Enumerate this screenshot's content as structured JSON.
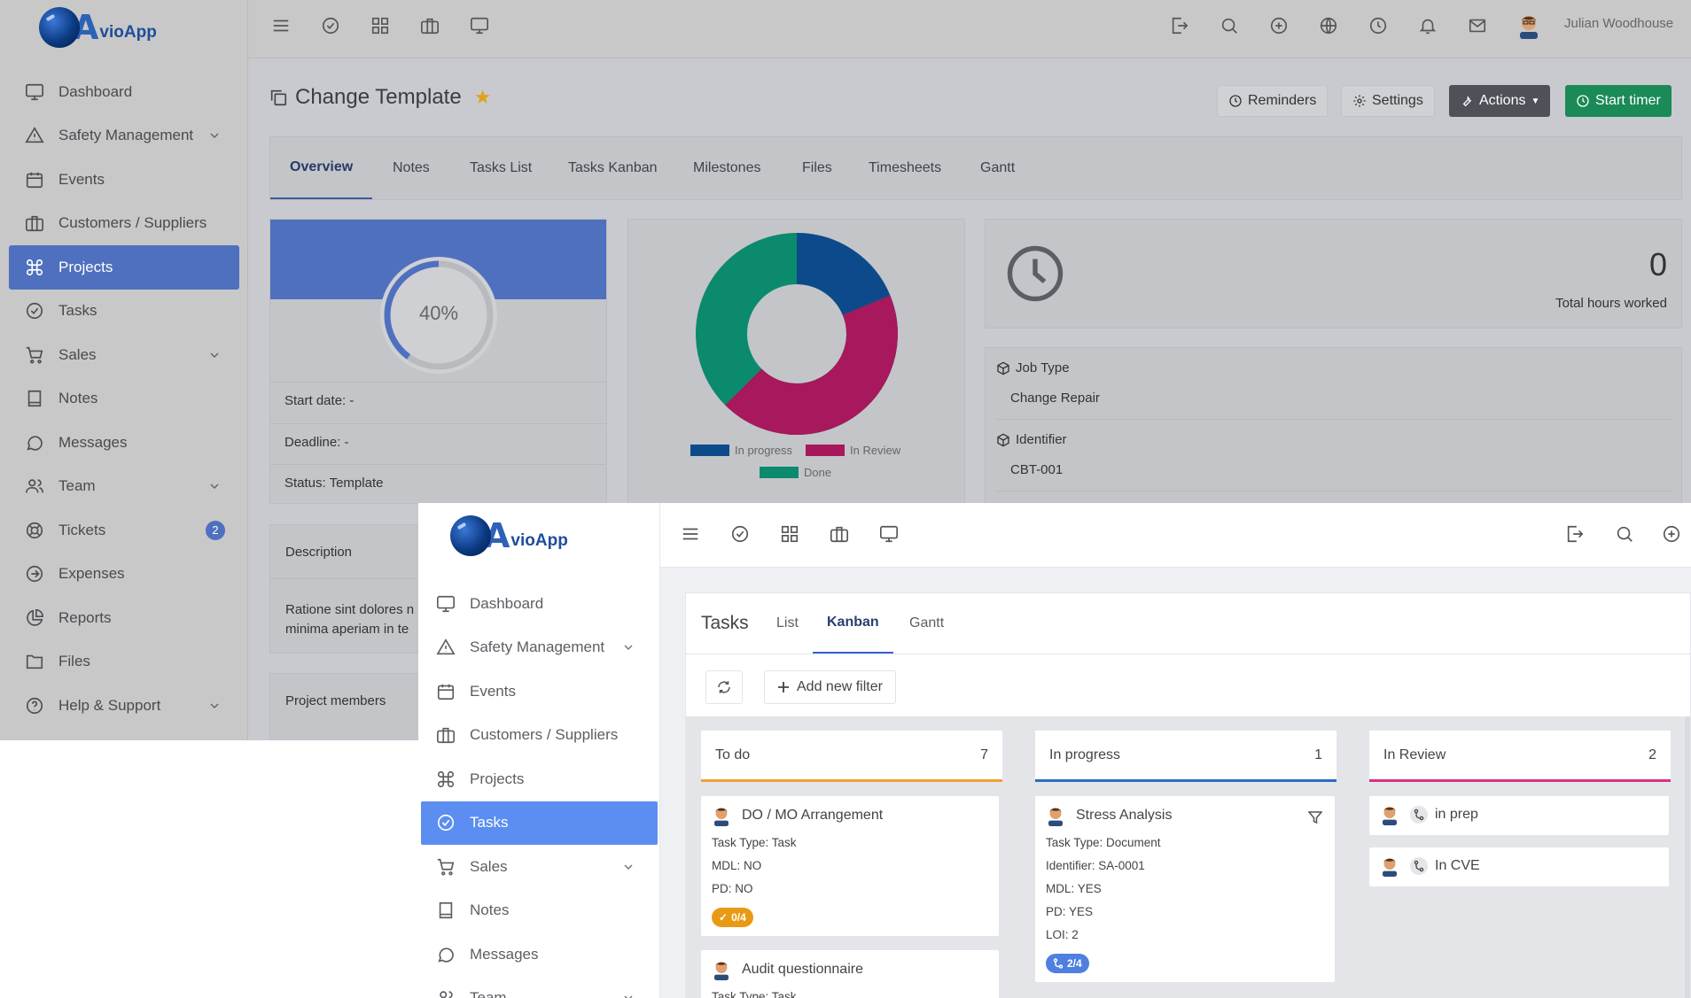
{
  "app": {
    "name_A": "A",
    "name_rest": "vioApp"
  },
  "user": {
    "name": "Julian Woodhouse"
  },
  "back": {
    "nav": [
      {
        "label": "Dashboard",
        "icon": "monitor-icon"
      },
      {
        "label": "Safety Management",
        "icon": "warning-icon",
        "has_children": true
      },
      {
        "label": "Events",
        "icon": "calendar-icon"
      },
      {
        "label": "Customers / Suppliers",
        "icon": "briefcase-icon"
      },
      {
        "label": "Projects",
        "icon": "command-icon",
        "active": true
      },
      {
        "label": "Tasks",
        "icon": "check-circle-icon"
      },
      {
        "label": "Sales",
        "icon": "cart-icon",
        "has_children": true
      },
      {
        "label": "Notes",
        "icon": "book-icon"
      },
      {
        "label": "Messages",
        "icon": "chat-icon"
      },
      {
        "label": "Team",
        "icon": "users-icon",
        "has_children": true
      },
      {
        "label": "Tickets",
        "icon": "lifebuoy-icon",
        "badge": "2"
      },
      {
        "label": "Expenses",
        "icon": "arrow-circle-icon"
      },
      {
        "label": "Reports",
        "icon": "pie-icon"
      },
      {
        "label": "Files",
        "icon": "folder-icon"
      },
      {
        "label": "Help & Support",
        "icon": "help-icon",
        "has_children": true
      }
    ],
    "page_title": "Change Template",
    "buttons": {
      "reminders": "Reminders",
      "settings": "Settings",
      "actions": "Actions",
      "start_timer": "Start timer"
    },
    "tabs": [
      "Overview",
      "Notes",
      "Tasks List",
      "Tasks Kanban",
      "Milestones",
      "Files",
      "Timesheets",
      "Gantt"
    ],
    "progress": {
      "percent_label": "40%",
      "value": 0.4
    },
    "info": {
      "start_date": "Start date: -",
      "deadline": "Deadline: -",
      "status": "Status: Template"
    },
    "donut_chart": {
      "legend": [
        "In progress",
        "In Review",
        "Done"
      ],
      "colors": {
        "in_progress": "#0d4a8c",
        "in_review": "#a8185c",
        "done": "#0b8a6d"
      }
    },
    "hours": {
      "value": "0",
      "label": "Total hours worked"
    },
    "fields": [
      {
        "label": "Job Type",
        "value": "Change Repair"
      },
      {
        "label": "Identifier",
        "value": "CBT-001"
      }
    ],
    "description": {
      "label": "Description",
      "text_line1": "Ratione sint dolores n",
      "text_line2": "minima aperiam in te"
    },
    "project_members": "Project members"
  },
  "front": {
    "nav": [
      {
        "label": "Dashboard"
      },
      {
        "label": "Safety Management"
      },
      {
        "label": "Events"
      },
      {
        "label": "Customers / Suppliers"
      },
      {
        "label": "Projects"
      },
      {
        "label": "Tasks"
      },
      {
        "label": "Sales"
      },
      {
        "label": "Notes"
      },
      {
        "label": "Messages"
      },
      {
        "label": "Team"
      }
    ],
    "tasks_title": "Tasks",
    "tabs": [
      "List",
      "Kanban",
      "Gantt"
    ],
    "add_filter": "Add new filter",
    "columns": [
      {
        "title": "To do",
        "count": "7",
        "color": "#f0a030"
      },
      {
        "title": "In progress",
        "count": "1",
        "color": "#2b6cc4"
      },
      {
        "title": "In Review",
        "count": "2",
        "color": "#d63384"
      }
    ],
    "todo_cards": [
      {
        "title": "DO / MO Arrangement",
        "lines": [
          "Task Type: Task",
          "MDL: NO",
          "PD: NO"
        ],
        "pill": "0/4"
      },
      {
        "title": "Audit questionnaire",
        "lines": [
          "Task Type: Task"
        ]
      }
    ],
    "progress_cards": [
      {
        "title": "Stress Analysis",
        "lines": [
          "Task Type: Document",
          "Identifier: SA-0001",
          "MDL: YES",
          "PD: YES",
          "LOI: 2"
        ],
        "pill": "2/4"
      }
    ],
    "review_cards": [
      {
        "title": "in prep"
      },
      {
        "title": "In CVE"
      }
    ]
  }
}
